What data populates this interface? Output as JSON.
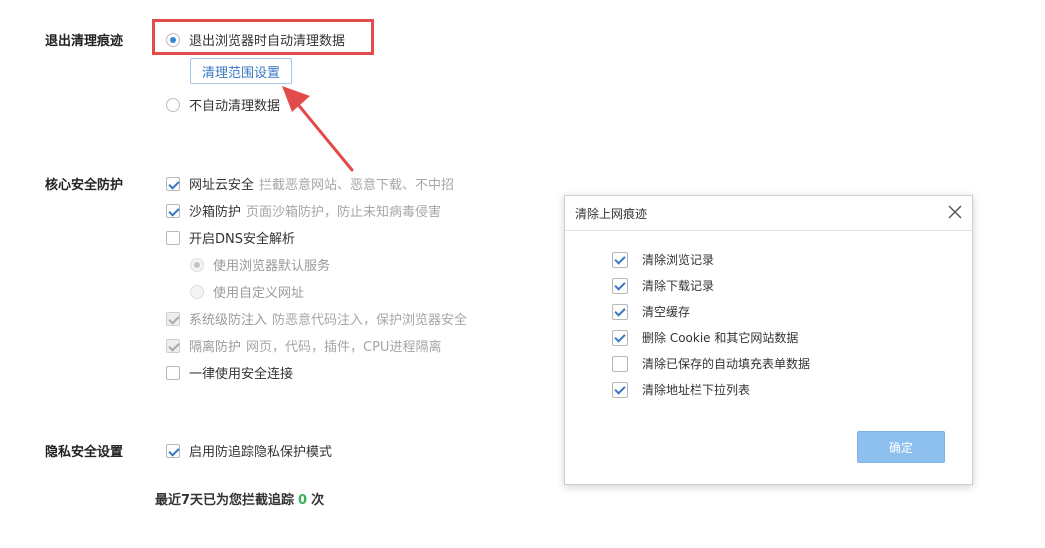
{
  "exit_trace": {
    "title": "退出清理痕迹",
    "auto_clear_label": "退出浏览器时自动清理数据",
    "range_button": "清理范围设置",
    "no_auto_clear_label": "不自动清理数据"
  },
  "core_protection": {
    "title": "核心安全防护",
    "items": [
      {
        "label": "网址云安全",
        "desc": "拦截恶意网站、恶意下载、不中招"
      },
      {
        "label": "沙箱防护",
        "desc": "页面沙箱防护，防止未知病毒侵害"
      },
      {
        "label": "开启DNS安全解析",
        "desc": ""
      },
      {
        "label": "使用浏览器默认服务"
      },
      {
        "label": "使用自定义网址"
      },
      {
        "label": "系统级防注入",
        "desc": "防恶意代码注入，保护浏览器安全"
      },
      {
        "label": "隔离防护",
        "desc": "网页，代码，插件，CPU进程隔离"
      },
      {
        "label": "一律使用安全连接",
        "desc": ""
      }
    ]
  },
  "privacy": {
    "title": "隐私安全设置",
    "anti_tracking_label": "启用防追踪隐私保护模式",
    "stat_prefix": "最近7天已为您拦截追踪",
    "stat_count": "0",
    "stat_suffix": "次"
  },
  "dialog": {
    "title": "清除上网痕迹",
    "items": [
      {
        "label": "清除浏览记录",
        "checked": true
      },
      {
        "label": "清除下载记录",
        "checked": true
      },
      {
        "label": "清空缓存",
        "checked": true
      },
      {
        "label": "删除 Cookie 和其它网站数据",
        "checked": true
      },
      {
        "label": "清除已保存的自动填充表单数据",
        "checked": false
      },
      {
        "label": "清除地址栏下拉列表",
        "checked": true
      }
    ],
    "confirm_label": "确定"
  },
  "colors": {
    "accent": "#3a78c4",
    "highlight": "#e34a4a",
    "stat_number": "#3ab05a",
    "confirm_button": "#8ec0ef"
  },
  "icons": [
    "close-icon",
    "arrow-annotation-icon"
  ]
}
